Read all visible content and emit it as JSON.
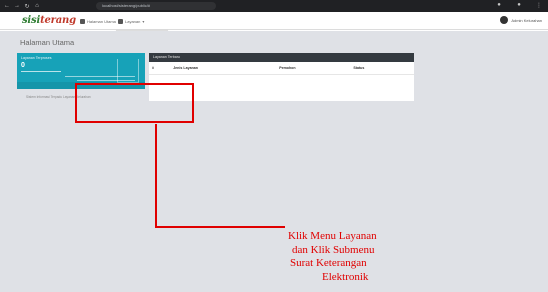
{
  "browser": {
    "url": "localhost/sisterang/public/#"
  },
  "header": {
    "logo_main": "sisi",
    "logo_accent": "terang",
    "nav": [
      {
        "label": "Halaman Utama"
      },
      {
        "label": "Layanan"
      }
    ],
    "user_name": "Admin Kelurahan"
  },
  "dropdown": {
    "items": [
      {
        "label": "Surat Keterangan Elektronik"
      }
    ]
  },
  "main": {
    "page_title": "Halaman Utama",
    "info_box": {
      "title": "Layanan Terproses",
      "value": "0"
    },
    "services_card": {
      "title": "Layanan Terbaru",
      "columns": [
        "#",
        "Jenis Layanan",
        "Pemohon",
        "Status"
      ]
    },
    "footer_text": "Sistem Informasi Terpadu Layanan Kelurahan"
  },
  "annotation": {
    "lines": [
      "Klik Menu  Layanan",
      "dan Klik Submenu",
      "Surat Keterangan",
      "Elektronik"
    ],
    "color": "#e00000"
  },
  "colors": {
    "teal": "#17a2b8",
    "header_dark": "#343a40",
    "background": "#dfe1e6",
    "logo_green": "#2e7d32",
    "logo_red": "#c0392b"
  }
}
